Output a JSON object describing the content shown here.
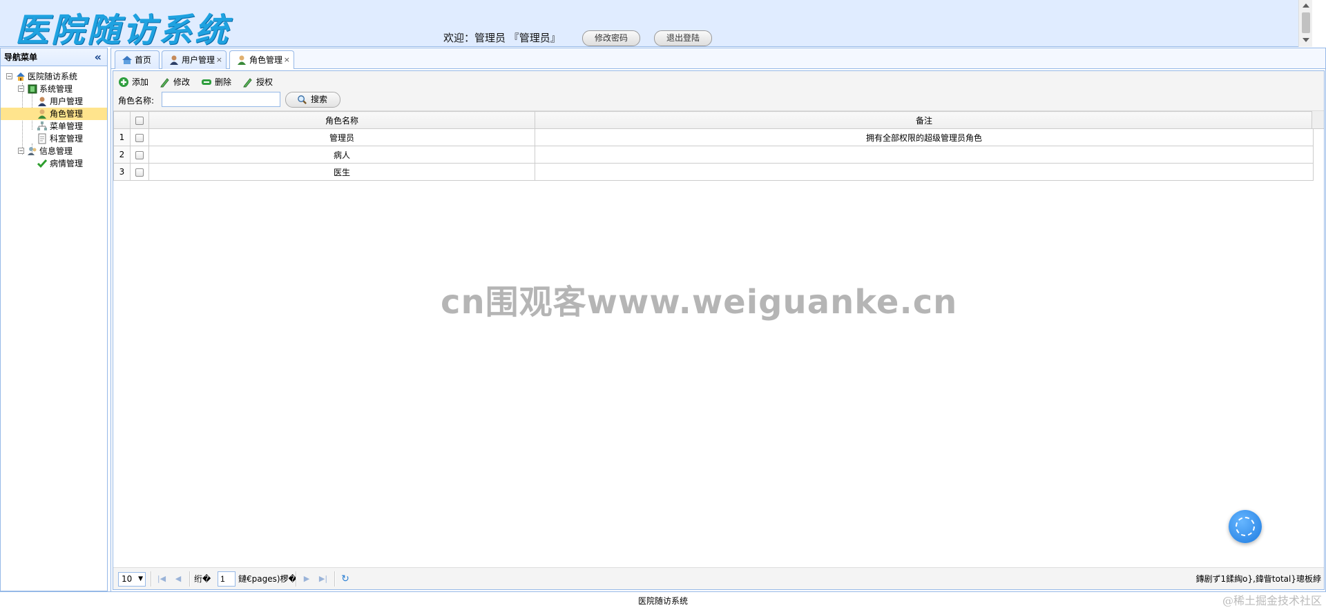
{
  "header": {
    "logo_text": "医院随访系统",
    "welcome_text": "欢迎：管理员 『管理员』",
    "change_password_label": "修改密码",
    "logout_label": "退出登陆"
  },
  "nav": {
    "title": "导航菜单",
    "collapse_icon": "«",
    "tree": {
      "root": "医院随访系统",
      "system_group": "系统管理",
      "user_mgmt": "用户管理",
      "role_mgmt": "角色管理",
      "menu_mgmt": "菜单管理",
      "dept_mgmt": "科室管理",
      "info_group": "信息管理",
      "illness_mgmt": "病情管理"
    }
  },
  "tabs": [
    {
      "label": "首页",
      "icon": "home-icon",
      "closable": false
    },
    {
      "label": "用户管理",
      "icon": "user-icon",
      "closable": true
    },
    {
      "label": "角色管理",
      "icon": "role-icon",
      "closable": true,
      "active": true
    }
  ],
  "tab_close_symbol": "×",
  "toolbar": {
    "add_label": "添加",
    "edit_label": "修改",
    "delete_label": "删除",
    "grant_label": "授权",
    "search_label": "角色名称:",
    "search_value": "",
    "search_button_label": "搜索"
  },
  "table": {
    "columns": [
      "角色名称",
      "备注"
    ],
    "rows": [
      {
        "num": "1",
        "name": "管理员",
        "note": "拥有全部权限的超级管理员角色"
      },
      {
        "num": "2",
        "name": "病人",
        "note": ""
      },
      {
        "num": "3",
        "name": "医生",
        "note": ""
      }
    ]
  },
  "pager": {
    "page_size": "10",
    "page_prefix": "绗�",
    "page_value": "1",
    "page_suffix": "鏈€pages)椤�",
    "info": "鏄剧ず1鍒綯o},鍏眥total}璁板綍"
  },
  "footer_text": "医院随访系统",
  "watermark_text": "cn围观客www.weiguanke.cn",
  "corner_text": "@稀土掘金技术社区",
  "colors": {
    "header_bg": "#e0ecff",
    "border": "#95b8e7",
    "logo": "#1fa2e0",
    "selected_node": "#ffe48d"
  }
}
